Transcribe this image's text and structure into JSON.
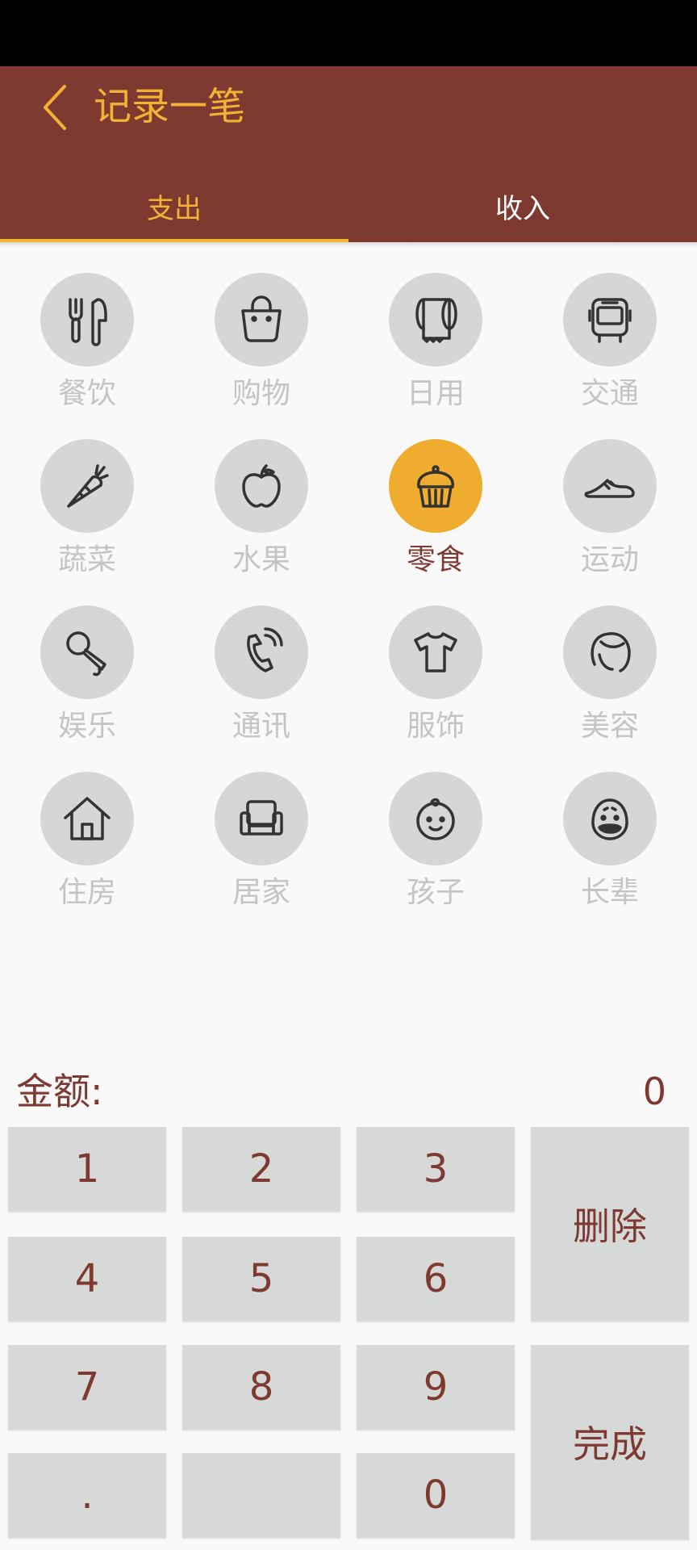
{
  "header": {
    "title": "记录一笔",
    "back_icon": "chevron-left-icon"
  },
  "tabs": {
    "expense": "支出",
    "income": "收入",
    "active": "expense"
  },
  "colors": {
    "header_bg": "#7e3931",
    "accent": "#f2b233",
    "icon_bg": "#d6d6d6",
    "icon_active_bg": "#f0ac2e",
    "label": "#c4c4c4",
    "key_bg": "#d7d8d8"
  },
  "categories": [
    {
      "label": "餐饮",
      "icon": "fork-knife-icon"
    },
    {
      "label": "购物",
      "icon": "shopping-bag-icon"
    },
    {
      "label": "日用",
      "icon": "toilet-roll-icon"
    },
    {
      "label": "交通",
      "icon": "bus-icon"
    },
    {
      "label": "蔬菜",
      "icon": "carrot-icon"
    },
    {
      "label": "水果",
      "icon": "apple-icon"
    },
    {
      "label": "零食",
      "icon": "cupcake-icon",
      "selected": true
    },
    {
      "label": "运动",
      "icon": "sneaker-icon"
    },
    {
      "label": "娱乐",
      "icon": "microphone-icon"
    },
    {
      "label": "通讯",
      "icon": "phone-icon"
    },
    {
      "label": "服饰",
      "icon": "tshirt-icon"
    },
    {
      "label": "美容",
      "icon": "woman-face-icon"
    },
    {
      "label": "住房",
      "icon": "house-icon"
    },
    {
      "label": "居家",
      "icon": "armchair-icon"
    },
    {
      "label": "孩子",
      "icon": "baby-face-icon"
    },
    {
      "label": "长辈",
      "icon": "elder-face-icon"
    }
  ],
  "amount": {
    "label": "金额:",
    "value": "0"
  },
  "keypad": {
    "k1": "1",
    "k2": "2",
    "k3": "3",
    "k4": "4",
    "k5": "5",
    "k6": "6",
    "k7": "7",
    "k8": "8",
    "k9": "9",
    "dot": ".",
    "blank": "",
    "k0": "0",
    "delete": "删除",
    "done": "完成"
  }
}
